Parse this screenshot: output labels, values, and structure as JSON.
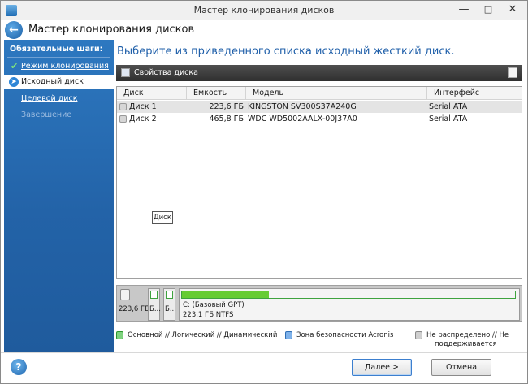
{
  "window": {
    "title": "Мастер клонирования дисков",
    "controls": {
      "minimize": "—",
      "maximize": "□",
      "close": "✕"
    }
  },
  "header": {
    "title": "Мастер клонирования дисков"
  },
  "sidebar": {
    "section_title": "Обязательные шаги:",
    "steps": [
      {
        "label": "Режим клонирования",
        "state": "done"
      },
      {
        "label": "Исходный диск",
        "state": "current"
      },
      {
        "label": "Целевой диск",
        "state": "link"
      },
      {
        "label": "Завершение",
        "state": "disabled"
      }
    ]
  },
  "main": {
    "title": "Выберите из приведенного списка исходный жесткий диск.",
    "toolbar": {
      "properties_label": "Свойства диска"
    },
    "table": {
      "columns": [
        "Диск",
        "Емкость",
        "Модель",
        "Интерфейс"
      ],
      "rows": [
        {
          "disk": "Диск 1",
          "capacity": "223,6 ГБ",
          "model": "KINGSTON SV300S37A240G",
          "interface": "Serial ATA",
          "selected": true
        },
        {
          "disk": "Диск 2",
          "capacity": "465,8 ГБ",
          "model": "WDC WD5002AALX-00J37A0",
          "interface": "Serial ATA",
          "selected": false
        }
      ]
    },
    "tooltip": "Диск"
  },
  "diskmap": {
    "size": "223,6 ГБ",
    "small_partitions": [
      "Б...",
      "Б..."
    ],
    "main_partition": {
      "line1": "C: (Базовый GPT)",
      "line2": "223,1 ГБ  NTFS",
      "used_fraction": 0.26
    }
  },
  "legend": {
    "primary": "Основной // Логический // Динамический",
    "acronis": "Зона безопасности Acronis",
    "unallocated_line1": "Не распределено // Не",
    "unallocated_line2": "поддерживается"
  },
  "footer": {
    "help": "?",
    "next": "Далее >",
    "cancel": "Отмена"
  },
  "colors": {
    "sidebar": "#2363a8",
    "title_accent": "#1f5fa9",
    "partition_fill": "#66cc33",
    "toolbar": "#3a3a3a"
  }
}
